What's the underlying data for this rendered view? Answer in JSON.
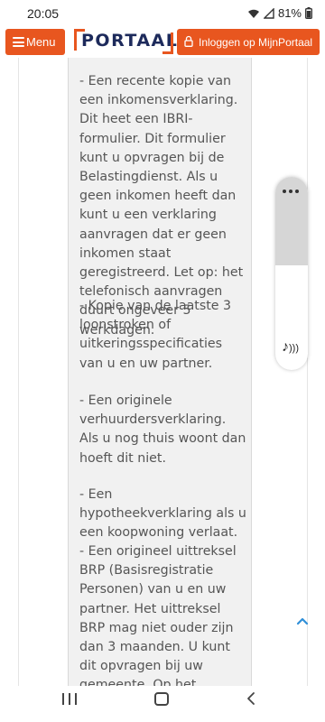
{
  "status_bar": {
    "time": "20:05",
    "battery": "81%",
    "icons": [
      "wifi-icon",
      "signal-icon",
      "battery-icon"
    ]
  },
  "header": {
    "menu_label": "Menu",
    "logo_text": "PORTAAL",
    "login_label": "Inloggen op MijnPortaal"
  },
  "content": {
    "paragraphs": [
      "- Een recente kopie van een inkomensverklaring. Dit heet een IBRI-formulier. Dit formulier kunt u opvragen bij de Belastingdienst. Als u geen inkomen heeft dan kunt u een verklaring aanvragen dat er geen inkomen staat geregistreerd. Let op: het telefonisch aanvragen duurt ongeveer 5 werkdagen.",
      "- Kopie van de laatste 3 loonstroken of uitkeringsspecificaties van u en uw partner.",
      "- Een originele verhuurdersverklaring. Als u nog thuis woont dan hoeft dit niet.",
      "- Een hypotheekverklaring als u een koopwoning verlaat.",
      "- Een origineel uittreksel BRP (Basisregistratie Personen) van u en uw partner. Het uittreksel BRP mag niet ouder zijn dan 3 maanden. U kunt dit opvragen bij uw gemeente. Op het uittreksel moet staan:"
    ]
  },
  "colors": {
    "brand_orange": "#e8561f",
    "brand_navy": "#1d2a5b",
    "content_box": "#f1f1f1",
    "scroll_arrow": "#2f8fd8"
  }
}
